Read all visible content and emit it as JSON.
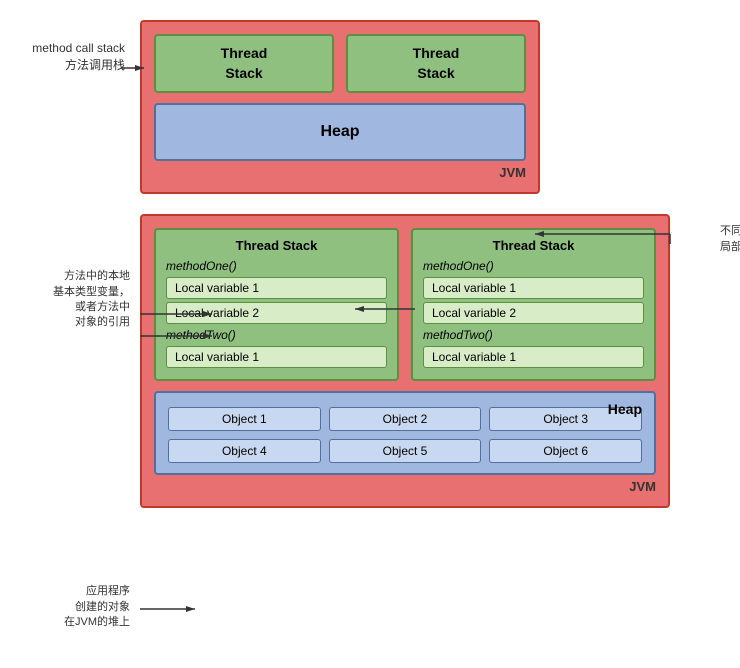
{
  "topDiagram": {
    "labelMethodCall": "method call stack\n方法调用栈",
    "jvmLabel": "JVM",
    "threadStack1": "Thread\nStack",
    "threadStack2": "Thread\nStack",
    "heap": "Heap"
  },
  "bottomDiagram": {
    "jvmLabel": "JVM",
    "heapLabel": "Heap",
    "annotLeftTop": "方法中的本地\n基本类型变量，\n或者方法中\n对象的引用",
    "annotLeftBottom": "应用程序\n创建的对象\n在JVM的堆上",
    "annotRightTop": "不同线程的方法\n局部变量不可共享",
    "stack1": {
      "title": "Thread Stack",
      "method1": "methodOne()",
      "localVars1": [
        "Local variable 1",
        "Local variable 2"
      ],
      "method2": "methodTwo()",
      "localVars2": [
        "Local variable 1"
      ]
    },
    "stack2": {
      "title": "Thread Stack",
      "method1": "methodOne()",
      "localVars1": [
        "Local variable 1",
        "Local variable 2"
      ],
      "method2": "methodTwo()",
      "localVars2": [
        "Local variable 1"
      ]
    },
    "objects": [
      "Object 1",
      "Object 2",
      "Object 3",
      "Object 4",
      "Object 5",
      "Object 6"
    ]
  }
}
